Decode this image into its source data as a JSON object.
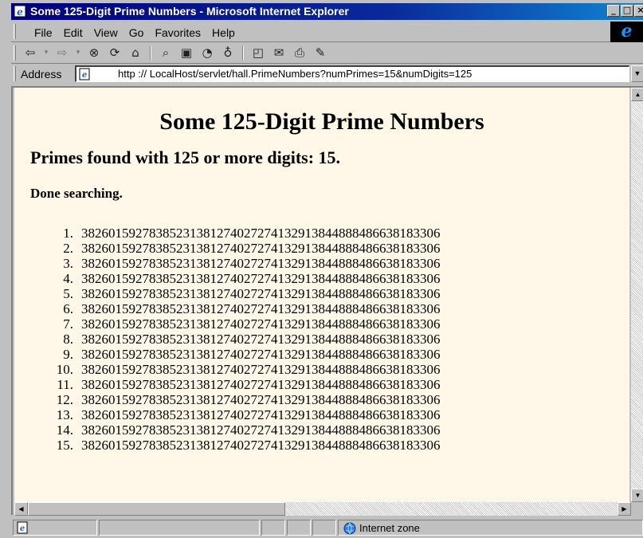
{
  "window": {
    "title": "Some 125-Digit Prime Numbers - Microsoft Internet Explorer",
    "controls": [
      "minimize",
      "maximize",
      "close"
    ]
  },
  "menu": {
    "items": [
      "File",
      "Edit",
      "View",
      "Go",
      "Favorites",
      "Help"
    ]
  },
  "toolbar": {
    "icons": [
      "back-icon",
      "forward-icon",
      "stop-icon",
      "refresh-icon",
      "home-icon",
      "search-icon",
      "favorites-icon",
      "history-icon",
      "channels-icon",
      "fullscreen-icon",
      "mail-icon",
      "print-icon",
      "edit-icon"
    ]
  },
  "address": {
    "label": "Address",
    "url": "http :// LocalHost/servlet/hall.PrimeNumbers?numPrimes=15&numDigits=125"
  },
  "page": {
    "heading": "Some 125-Digit Prime Numbers",
    "summary": "Primes found with 125 or more digits: 15.",
    "status": "Done searching.",
    "primes": [
      {
        "num": "1.",
        "value": "38260159278385231381274027274132913844888486638183306"
      },
      {
        "num": "2.",
        "value": "38260159278385231381274027274132913844888486638183306"
      },
      {
        "num": "3.",
        "value": "38260159278385231381274027274132913844888486638183306"
      },
      {
        "num": "4.",
        "value": "38260159278385231381274027274132913844888486638183306"
      },
      {
        "num": "5.",
        "value": "38260159278385231381274027274132913844888486638183306"
      },
      {
        "num": "6.",
        "value": "38260159278385231381274027274132913844888486638183306"
      },
      {
        "num": "7.",
        "value": "38260159278385231381274027274132913844888486638183306"
      },
      {
        "num": "8.",
        "value": "38260159278385231381274027274132913844888486638183306"
      },
      {
        "num": "9.",
        "value": "38260159278385231381274027274132913844888486638183306"
      },
      {
        "num": "10.",
        "value": "38260159278385231381274027274132913844888486638183306"
      },
      {
        "num": "11.",
        "value": "38260159278385231381274027274132913844888486638183306"
      },
      {
        "num": "12.",
        "value": "38260159278385231381274027274132913844888486638183306"
      },
      {
        "num": "13.",
        "value": "38260159278385231381274027274132913844888486638183306"
      },
      {
        "num": "14.",
        "value": "38260159278385231381274027274132913844888486638183306"
      },
      {
        "num": "15.",
        "value": "38260159278385231381274027274132913844888486638183306"
      }
    ]
  },
  "statusbar": {
    "zone": "Internet zone"
  },
  "colors": {
    "titlebar": "#000080",
    "page_background": "#fff8e8",
    "chrome": "#c0c0c0"
  }
}
